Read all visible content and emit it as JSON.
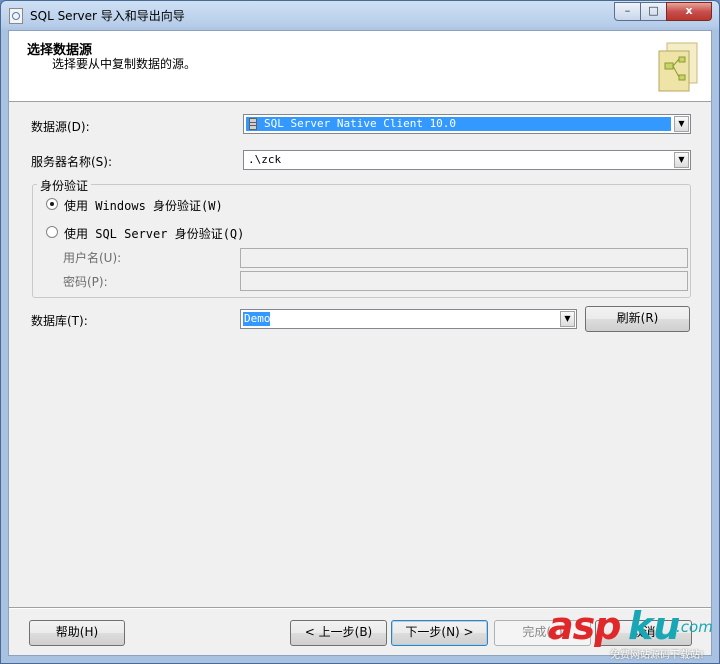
{
  "window": {
    "title": "SQL Server 导入和导出向导",
    "min": "–",
    "max": "□",
    "close": "x"
  },
  "header": {
    "title": "选择数据源",
    "subtitle": "选择要从中复制数据的源。"
  },
  "datasource": {
    "label": "数据源(D):",
    "value": "SQL Server Native Client 10.0"
  },
  "server": {
    "label": "服务器名称(S):",
    "value": ".\\zck"
  },
  "auth": {
    "legend": "身份验证",
    "windows_label": "使用 Windows 身份验证(W)",
    "sql_label": "使用 SQL Server 身份验证(Q)",
    "selected": "windows",
    "username_label": "用户名(U):",
    "password_label": "密码(P):",
    "username_value": "",
    "password_value": ""
  },
  "database": {
    "label": "数据库(T):",
    "value": "Demo",
    "refresh_label": "刷新(R)"
  },
  "footer": {
    "help": "帮助(H)",
    "back": "< 上一步(B)",
    "next": "下一步(N) >",
    "finish": "完成(F)",
    "cancel": "取消"
  },
  "watermark": {
    "brand_a": "asp",
    "brand_b": "ku",
    "brand_c": ".com",
    "tagline": "免费网站源码下载站!"
  },
  "colors": {
    "accent": "#3399ff",
    "watermark_red": "#e0282a",
    "watermark_teal": "#1aa7b5"
  }
}
